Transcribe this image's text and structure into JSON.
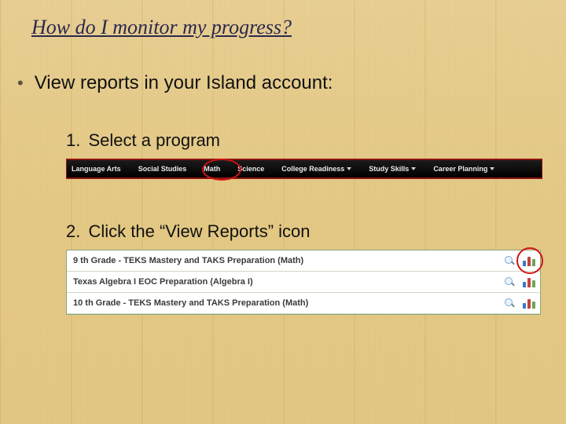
{
  "title": "How do I monitor my progress?",
  "bullet": "View reports in your Island account:",
  "steps": {
    "s1": {
      "num": "1.",
      "text": "Select a program"
    },
    "s2": {
      "num": "2.",
      "text": "Click the  “View Reports” icon"
    }
  },
  "programs": {
    "items": [
      {
        "label": "Language Arts",
        "dropdown": false
      },
      {
        "label": "Social Studies",
        "dropdown": false
      },
      {
        "label": "Math",
        "dropdown": false,
        "highlighted": true
      },
      {
        "label": "Science",
        "dropdown": false
      },
      {
        "label": "College Readiness",
        "dropdown": true
      },
      {
        "label": "Study Skills",
        "dropdown": true
      },
      {
        "label": "Career Planning",
        "dropdown": true
      }
    ]
  },
  "reports": {
    "rows": [
      {
        "label": "9 th Grade - TEKS Mastery and TAKS Preparation (Math)",
        "highlighted": true
      },
      {
        "label": "Texas Algebra I EOC Preparation (Algebra I)"
      },
      {
        "label": "10 th Grade - TEKS Mastery and TAKS Preparation (Math)"
      }
    ]
  },
  "icons": {
    "magnify": "magnify-icon",
    "bar_chart": "bar-chart-icon"
  }
}
